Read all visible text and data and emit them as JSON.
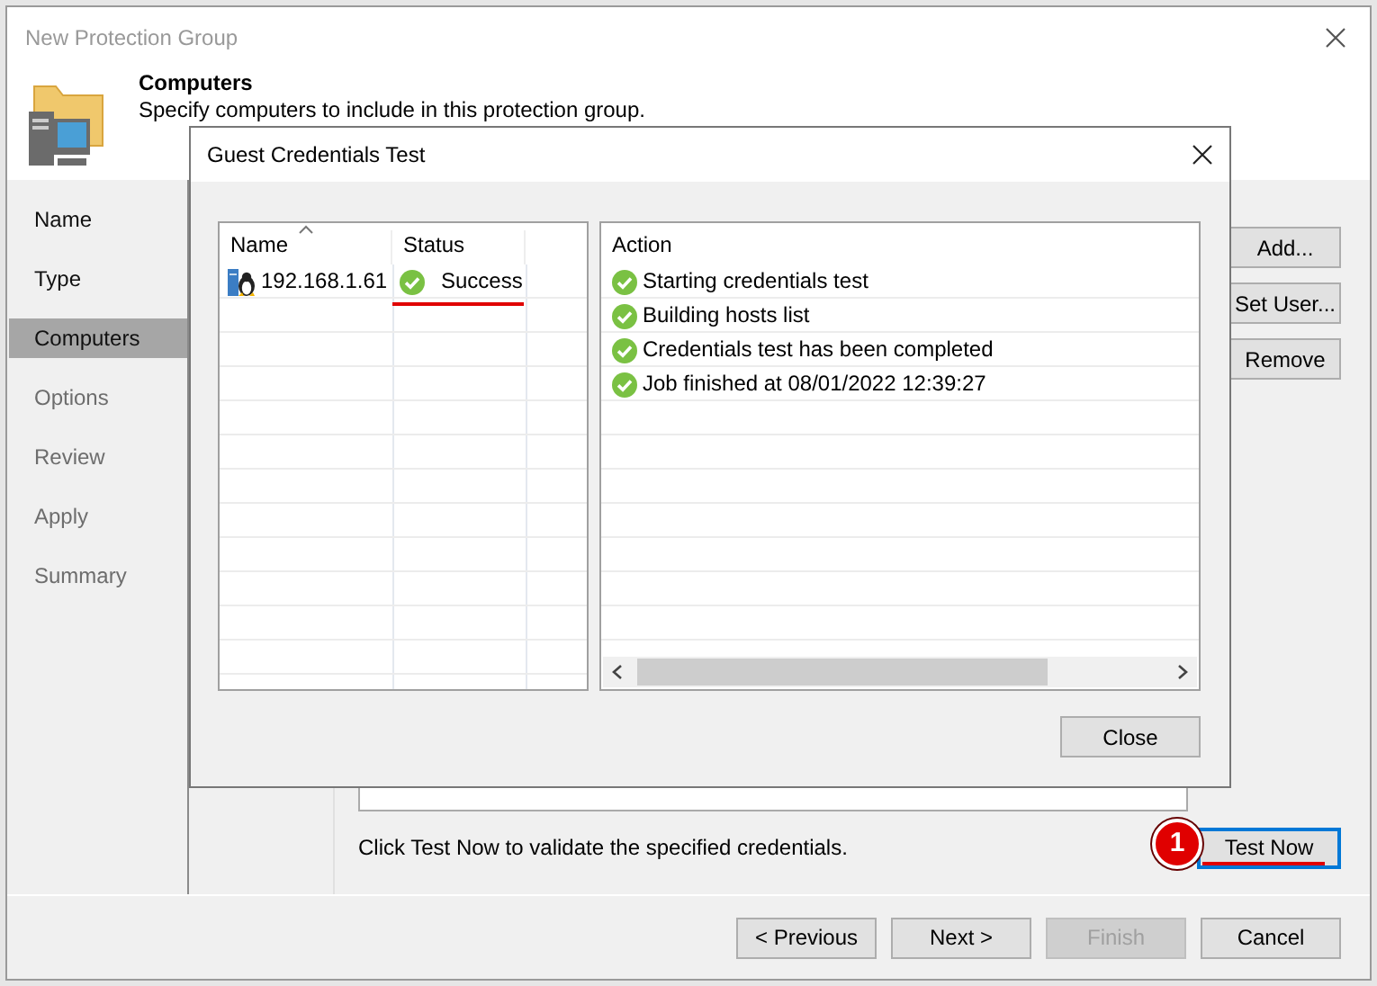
{
  "window": {
    "title": "New Protection Group"
  },
  "header": {
    "title": "Computers",
    "subtitle": "Specify computers to include in this protection group."
  },
  "steps": [
    {
      "label": "Name",
      "selected": false,
      "enabled": true
    },
    {
      "label": "Type",
      "selected": false,
      "enabled": true
    },
    {
      "label": "Computers",
      "selected": true,
      "enabled": true
    },
    {
      "label": "Options",
      "selected": false,
      "enabled": false
    },
    {
      "label": "Review",
      "selected": false,
      "enabled": false
    },
    {
      "label": "Apply",
      "selected": false,
      "enabled": false
    },
    {
      "label": "Summary",
      "selected": false,
      "enabled": false
    }
  ],
  "side_buttons": [
    "Add...",
    "Set User...",
    "Remove"
  ],
  "hint": "Click Test Now to validate the specified credentials.",
  "test_button": {
    "label": "Test Now",
    "focused": true
  },
  "annotation": {
    "badge": "1"
  },
  "footer_buttons": [
    {
      "label": "< Previous",
      "disabled": false
    },
    {
      "label": "Next >",
      "disabled": false
    },
    {
      "label": "Finish",
      "disabled": true
    },
    {
      "label": "Cancel",
      "disabled": false
    }
  ],
  "dialog": {
    "title": "Guest Credentials Test",
    "hosts": {
      "columns": [
        "Name",
        "Status"
      ],
      "rows": [
        {
          "name": "192.168.1.61",
          "status": "Success",
          "kind": "success"
        }
      ]
    },
    "actions": {
      "column": "Action",
      "rows": [
        {
          "text": "Starting credentials test",
          "kind": "success"
        },
        {
          "text": "Building hosts list",
          "kind": "success"
        },
        {
          "text": "Credentials test has been completed",
          "kind": "success"
        },
        {
          "text": "Job finished at 08/01/2022 12:39:27",
          "kind": "success"
        }
      ]
    },
    "close_button": "Close"
  }
}
